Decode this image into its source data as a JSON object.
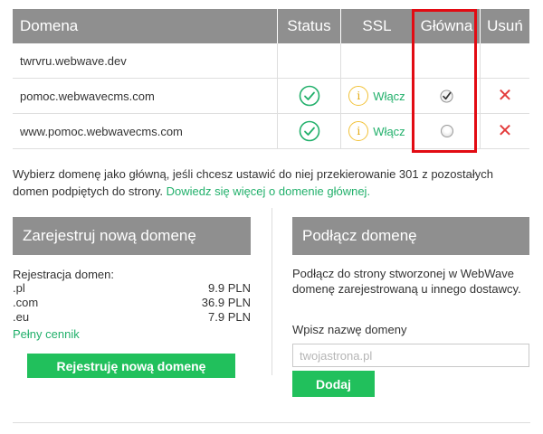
{
  "table": {
    "headers": {
      "domain": "Domena",
      "status": "Status",
      "ssl": "SSL",
      "main": "Główna",
      "remove": "Usuń"
    },
    "rows": [
      {
        "domain": "twrvru.webwave.dev",
        "status": "",
        "ssl_label": "",
        "main": "",
        "remove": ""
      },
      {
        "domain": "pomoc.webwavecms.com",
        "status": "ok",
        "ssl_label": "Włącz",
        "main": "checked",
        "remove": "✕"
      },
      {
        "domain": "www.pomoc.webwavecms.com",
        "status": "ok",
        "ssl_label": "Włącz",
        "main": "unchecked",
        "remove": "✕"
      }
    ],
    "info_icon_glyph": "i"
  },
  "info": {
    "text": "Wybierz domenę jako główną, jeśli chcesz ustawić do niej przekierowanie 301 z pozostałych domen podpiętych do strony.",
    "link": "Dowiedz się więcej o domenie głównej."
  },
  "register": {
    "title": "Zarejestruj nową domenę",
    "subtitle": "Rejestracja domen:",
    "prices": [
      {
        "tld": ".pl",
        "price": "9.9 PLN"
      },
      {
        "tld": ".com",
        "price": "36.9 PLN"
      },
      {
        "tld": ".eu",
        "price": "7.9 PLN"
      }
    ],
    "full_price_link": "Pełny cennik",
    "button": "Rejestruję nową domenę"
  },
  "connect": {
    "title": "Podłącz domenę",
    "description": "Podłącz do strony stworzonej w WebWave domenę zarejestrowaną u innego dostawcy.",
    "input_label": "Wpisz nazwę domeny",
    "input_placeholder": "twojastrona.pl",
    "input_value": "",
    "button": "Dodaj"
  },
  "colors": {
    "accent": "#22b06b",
    "button": "#21c05c",
    "header": "#8f8f8f",
    "delete": "#e33b3b",
    "highlight": "#e20b13",
    "ssl_warning": "#f2c238"
  }
}
